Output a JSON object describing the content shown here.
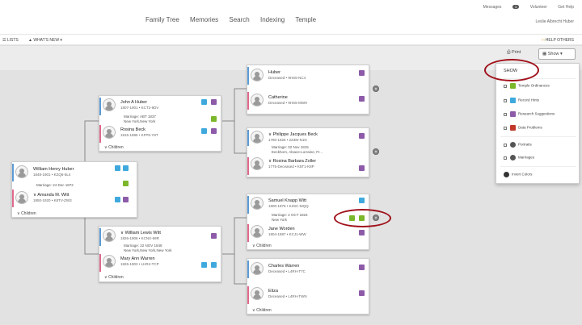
{
  "header": {
    "nav": [
      "Family Tree",
      "Memories",
      "Search",
      "Indexing",
      "Temple"
    ],
    "messages_label": "Messages",
    "messages_count": "1",
    "volunteer_label": "Volunteer",
    "help_label": "Get Help",
    "username": "Leslie Albrecht Huber"
  },
  "toolbar": {
    "lists": "LISTS",
    "whats_new": "WHAT'S NEW",
    "help_others": "HELP OTHERS",
    "print": "Print",
    "show": "Show"
  },
  "colors": {
    "male": "#5b9bd5",
    "female": "#e06a8c",
    "memories": "#3fa9dd",
    "temple": "#7bb72a",
    "research": "#8d5ba8"
  },
  "cards": {
    "c1": {
      "husband": {
        "name": "William Henry Huber",
        "info": "1848-1901 • KZQ6-5L4"
      },
      "marriage": [
        "Marriage: 24 Dec 1872"
      ],
      "wife": {
        "name": "Amanda M. Witt",
        "info": "1850-1920 • K8TV-ZW3"
      },
      "children": "Children"
    },
    "c2": {
      "husband": {
        "name": "John A Huber",
        "info": "1807-1901 • KCT2-9DV"
      },
      "marriage": [
        "Marriage: ABT 1837",
        "New York,New York"
      ],
      "wife": {
        "name": "Rosina Beck",
        "info": "1815-1895 • KFP6-Y8T"
      },
      "children": "Children"
    },
    "c3": {
      "husband": {
        "name": "William Lewis Witt",
        "info": "1826-1906 • KCNX-69R"
      },
      "marriage": [
        "Marriage: 22 NOV 1848",
        "New York,New York,New York"
      ],
      "wife": {
        "name": "Mary Ann Warren",
        "info": "1826-1903 • LHR4-TCP"
      },
      "children": "Children"
    },
    "c4": {
      "husband": {
        "name": "Huber",
        "info": "Deceased • 9HS5-NC4"
      },
      "wife": {
        "name": "Catherine",
        "info": "Deceased • 9HS5-MWH"
      }
    },
    "c5": {
      "husband": {
        "name": "Philippe Jacques Beck",
        "info": "1780-1826 • 2Z3M-N1N"
      },
      "marriage": [
        "Marriage: 02 Nov 1815",
        "Eeckhorn, Alsace-Lorraine, Fr..."
      ],
      "wife": {
        "name": "Rosina Barbara Zoller",
        "info": "1775-Deceased • K5T1-K8P"
      }
    },
    "c6": {
      "husband": {
        "name": "Samuel Knapp Witt",
        "info": "1800-1876 • K2SC-MQQ"
      },
      "marriage": [
        "Marriage: 2 OCT 1824",
        "New York"
      ],
      "wife": {
        "name": "Jane Worden",
        "info": "1804-1887 • KCJ1-WW"
      },
      "children": "Children"
    },
    "c7": {
      "husband": {
        "name": "Charles Warren",
        "info": "Deceased • L4RH-T7C"
      },
      "wife": {
        "name": "Eliza",
        "info": "Deceased • L4RH-TWN"
      },
      "children": "Children"
    }
  },
  "show_panel": {
    "title": "SHOW",
    "options": [
      "Temple Ordinances",
      "Record Hints",
      "Research Suggestions",
      "Data Problems",
      "Portraits",
      "Marriages",
      "Invert Colors"
    ]
  }
}
